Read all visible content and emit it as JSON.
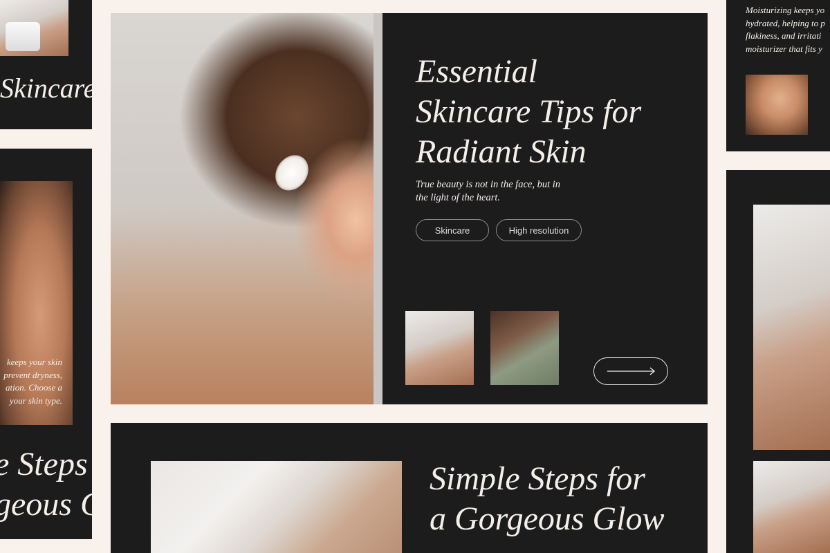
{
  "hero": {
    "title_line1": "Essential",
    "title_line2": "Skincare Tips for",
    "title_line3": "Radiant Skin",
    "quote_line1": "True beauty is not in the face, but in",
    "quote_line2": "the light of the heart.",
    "tags": [
      "Skincare",
      "High resolution"
    ],
    "arrow_icon": "long-right-arrow-icon"
  },
  "bottom_card": {
    "title_line1": "Simple Steps for",
    "title_line2": "a Gorgeous Glow"
  },
  "left_top_card": {
    "title": "Skincare"
  },
  "left_mid_card": {
    "text_line1": "keeps your skin",
    "text_line2": "prevent dryness,",
    "text_line3": "ation. Choose a",
    "text_line4": "your skin type.",
    "title_line1": "e Steps f",
    "title_line2": "geous Gl"
  },
  "right_top_card": {
    "text_line1": "Moisturizing keeps yo",
    "text_line2": "hydrated, helping to p",
    "text_line3": "flakiness, and irritati",
    "text_line4": "moisturizer that fits y"
  },
  "colors": {
    "background": "#f9f1ec",
    "card": "#1c1c1c",
    "text": "#f4efe9",
    "tag_border": "#8b8b8b"
  }
}
